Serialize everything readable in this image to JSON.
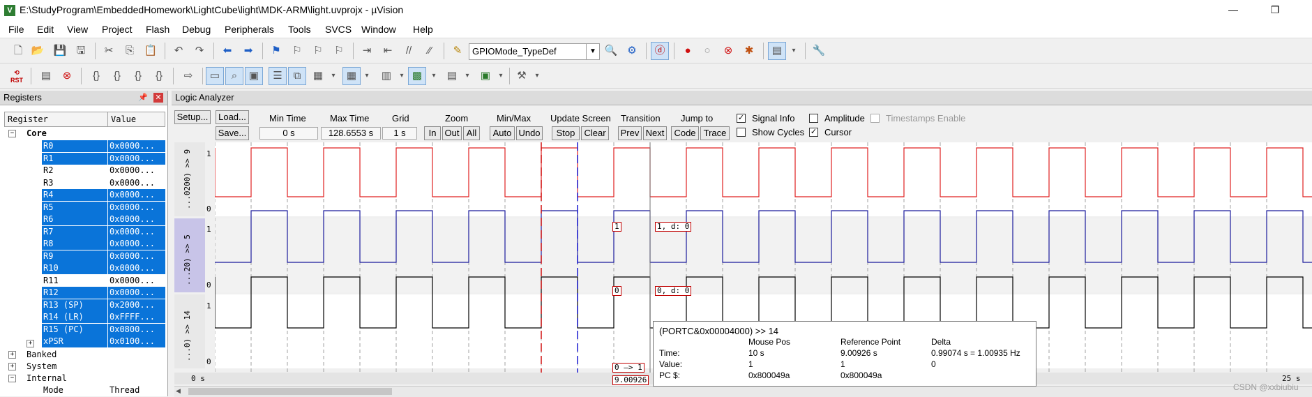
{
  "window": {
    "title": "E:\\StudyProgram\\EmbeddedHomework\\LightCube\\light\\MDK-ARM\\light.uvprojx - µVision",
    "app_icon": "V",
    "minimize": "—",
    "restore": "❐"
  },
  "menu": [
    "File",
    "Edit",
    "View",
    "Project",
    "Flash",
    "Debug",
    "Peripherals",
    "Tools",
    "SVCS",
    "Window",
    "Help"
  ],
  "toolbar": {
    "combo_value": "GPIOMode_TypeDef"
  },
  "registers": {
    "title": "Registers",
    "col_register": "Register",
    "col_value": "Value",
    "core_label": "Core",
    "rows": [
      {
        "name": "R0",
        "value": "0x0000...",
        "selected": true
      },
      {
        "name": "R1",
        "value": "0x0000...",
        "selected": true
      },
      {
        "name": "R2",
        "value": "0x0000...",
        "selected": false
      },
      {
        "name": "R3",
        "value": "0x0000...",
        "selected": false
      },
      {
        "name": "R4",
        "value": "0x0000...",
        "selected": true
      },
      {
        "name": "R5",
        "value": "0x0000...",
        "selected": true
      },
      {
        "name": "R6",
        "value": "0x0000...",
        "selected": true
      },
      {
        "name": "R7",
        "value": "0x0000...",
        "selected": true
      },
      {
        "name": "R8",
        "value": "0x0000...",
        "selected": true
      },
      {
        "name": "R9",
        "value": "0x0000...",
        "selected": true
      },
      {
        "name": "R10",
        "value": "0x0000...",
        "selected": true
      },
      {
        "name": "R11",
        "value": "0x0000...",
        "selected": false
      },
      {
        "name": "R12",
        "value": "0x0000...",
        "selected": true
      },
      {
        "name": "R13 (SP)",
        "value": "0x2000...",
        "selected": true
      },
      {
        "name": "R14 (LR)",
        "value": "0xFFFF...",
        "selected": true
      },
      {
        "name": "R15 (PC)",
        "value": "0x0800...",
        "selected": true
      },
      {
        "name": "xPSR",
        "value": "0x0100...",
        "selected": true
      }
    ],
    "banked": "Banked",
    "system": "System",
    "internal": "Internal",
    "mode_label": "Mode",
    "mode_value": "Thread"
  },
  "la": {
    "title": "Logic Analyzer",
    "setup": "Setup...",
    "load": "Load...",
    "save": "Save...",
    "min_time_label": "Min Time",
    "min_time": "0 s",
    "max_time_label": "Max Time",
    "max_time": "128.6553 s",
    "grid_label": "Grid",
    "grid": "1 s",
    "zoom_label": "Zoom",
    "zoom_in": "In",
    "zoom_out": "Out",
    "zoom_all": "All",
    "minmax_label": "Min/Max",
    "auto": "Auto",
    "undo": "Undo",
    "update_label": "Update Screen",
    "stop": "Stop",
    "clear": "Clear",
    "transition_label": "Transition",
    "prev": "Prev",
    "next": "Next",
    "jump_label": "Jump to",
    "code": "Code",
    "trace": "Trace",
    "signal_info": "Signal Info",
    "show_cycles": "Show Cycles",
    "amplitude": "Amplitude",
    "cursor": "Cursor",
    "timestamps": "Timestamps Enable",
    "signals": [
      {
        "label": "...0200) >> 9",
        "hi": "1",
        "lo": "0",
        "color": "#e02020"
      },
      {
        "label": "...20) >> 5",
        "hi": "1",
        "lo": "0",
        "color": "#1a1a9c"
      },
      {
        "label": "...0) >> 14",
        "hi": "1",
        "lo": "0",
        "color": "#000000"
      }
    ],
    "markers": {
      "s1_a": "1",
      "s1_b": "1,  d: 0",
      "s2_a": "0",
      "s2_b": "0,  d: 0",
      "s3_a": "0 —> 1",
      "time_box": "9.00926"
    },
    "axis_start": "0 s",
    "axis_end": "25 s"
  },
  "tooltip": {
    "title": "(PORTC&0x00004000) >> 14",
    "col_mouse": "Mouse Pos",
    "col_ref": "Reference Point",
    "col_delta": "Delta",
    "time_label": "Time:",
    "value_label": "Value:",
    "pc_label": "PC $:",
    "mouse_time": "10 s",
    "ref_time": "9.00926 s",
    "delta_time": "0.99074 s = 1.00935 Hz",
    "mouse_value": "1",
    "ref_value": "1",
    "delta_value": "0",
    "mouse_pc": "0x800049a",
    "ref_pc": "0x800049a"
  },
  "watermark": "CSDN @xxbiubiu"
}
